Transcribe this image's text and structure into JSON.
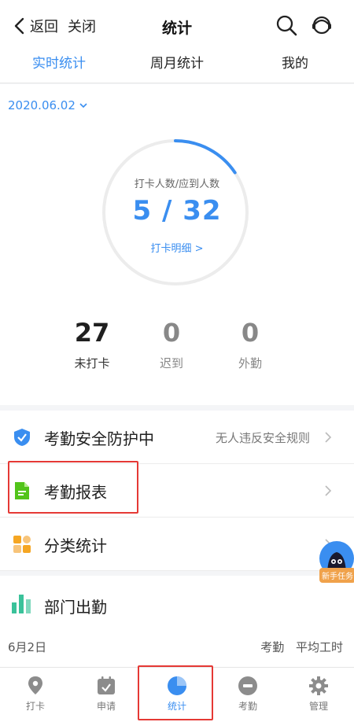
{
  "header": {
    "back_label": "返回",
    "close_label": "关闭",
    "title": "统计"
  },
  "tabs": [
    {
      "label": "实时统计",
      "active": true
    },
    {
      "label": "周月统计",
      "active": false
    },
    {
      "label": "我的",
      "active": false
    }
  ],
  "stats": {
    "date": "2020.06.02",
    "ring_label": "打卡人数/应到人数",
    "ring_value": "5 / 32",
    "ring_progress": 0.15625,
    "detail_link": "打卡明细 >",
    "metrics": [
      {
        "value": "27",
        "label": "未打卡",
        "color": "#1f1f1f"
      },
      {
        "value": "0",
        "label": "迟到",
        "color": "#888888"
      },
      {
        "value": "0",
        "label": "外勤",
        "color": "#888888"
      }
    ]
  },
  "list": [
    {
      "title": "考勤安全防护中",
      "note": "无人违反安全规则",
      "icon": "shield-check-icon"
    },
    {
      "title": "考勤报表",
      "note": "",
      "icon": "report-doc-icon"
    },
    {
      "title": "分类统计",
      "note": "",
      "icon": "category-grid-icon"
    }
  ],
  "dept": {
    "title": "部门出勤",
    "date": "6月2日",
    "col1": "考勤",
    "col2": "平均工时"
  },
  "task_badge": {
    "label": "新手任务"
  },
  "bottom_nav": [
    {
      "label": "打卡",
      "icon": "location-pin-icon",
      "active": false
    },
    {
      "label": "申请",
      "icon": "calendar-icon",
      "active": false
    },
    {
      "label": "统计",
      "icon": "pie-chart-icon",
      "active": true
    },
    {
      "label": "考勤",
      "icon": "clock-icon",
      "active": false
    },
    {
      "label": "管理",
      "icon": "gear-icon",
      "active": false
    }
  ],
  "colors": {
    "accent": "#3a8ef0",
    "highlight": "#e53935",
    "badge": "#f0a24b"
  }
}
